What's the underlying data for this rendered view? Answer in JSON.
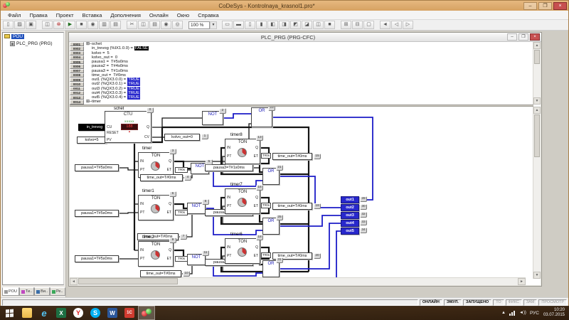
{
  "window": {
    "title": "CoDeSys - Kontrolnaya_krasnol1.pro*",
    "minimize": "–",
    "maximize": "❐",
    "close": "×"
  },
  "menu": {
    "items": [
      "Файл",
      "Правка",
      "Проект",
      "Вставка",
      "Дополнения",
      "Онлайн",
      "Окно",
      "Справка"
    ]
  },
  "toolbar": {
    "zoom_value": "100 %",
    "zoom_drop": "▼",
    "groups": [
      {
        "buttons": [
          {
            "name": "new-file",
            "glyph": "▯"
          },
          {
            "name": "open-file",
            "glyph": "▨"
          },
          {
            "name": "save-file",
            "glyph": "▣"
          }
        ]
      },
      {
        "buttons": [
          {
            "name": "login",
            "glyph": "◫"
          },
          {
            "name": "logout",
            "glyph": "⊗"
          },
          {
            "name": "run",
            "glyph": "▶"
          },
          {
            "name": "stop",
            "glyph": "■"
          },
          {
            "name": "toggle-breakpoint",
            "glyph": "◉"
          },
          {
            "name": "step-over",
            "glyph": "▥"
          },
          {
            "name": "step-in",
            "glyph": "▤"
          }
        ]
      },
      {
        "buttons": [
          {
            "name": "cut",
            "glyph": "✂"
          },
          {
            "name": "copy",
            "glyph": "◫"
          },
          {
            "name": "paste",
            "glyph": "▤"
          },
          {
            "name": "find",
            "glyph": "◉"
          },
          {
            "name": "find-next",
            "glyph": "◎"
          }
        ]
      },
      {
        "buttons": [
          {
            "name": "size-1",
            "glyph": "▭"
          },
          {
            "name": "size-2",
            "glyph": "▬"
          },
          {
            "name": "size-3",
            "glyph": "▯"
          },
          {
            "name": "size-4",
            "glyph": "▮"
          },
          {
            "name": "align-left",
            "glyph": "◧"
          },
          {
            "name": "align-right",
            "glyph": "◨"
          },
          {
            "name": "align-top",
            "glyph": "◩"
          },
          {
            "name": "align-bottom",
            "glyph": "◪"
          },
          {
            "name": "order-front",
            "glyph": "◫"
          },
          {
            "name": "order-back",
            "glyph": "■"
          }
        ]
      },
      {
        "buttons": [
          {
            "name": "zoom-in",
            "glyph": "⊞"
          },
          {
            "name": "zoom-out",
            "glyph": "⊟"
          },
          {
            "name": "zoom-fit",
            "glyph": "▢"
          }
        ]
      },
      {
        "buttons": [
          {
            "name": "go-first",
            "glyph": "◄"
          },
          {
            "name": "go-prev",
            "glyph": "◁"
          },
          {
            "name": "go-next",
            "glyph": "▷"
          }
        ]
      }
    ]
  },
  "sidebar": {
    "root": "POU",
    "child": "PLC_PRG (PRG)",
    "tabs": [
      {
        "label": "POU"
      },
      {
        "label": "Ти.."
      },
      {
        "label": "Ви.."
      },
      {
        "label": "Ре.."
      }
    ]
  },
  "editor": {
    "title": "PLC_PRG (PRG-CFC)",
    "minimize": "–",
    "maximize": "❐",
    "close": "×",
    "declarations": [
      {
        "num": "0001",
        "label": "⊞–schet",
        "value": ""
      },
      {
        "num": "0002",
        "label": "in_trevog (%IX1.0.0) =",
        "value": "FALSE"
      },
      {
        "num": "0003",
        "label": "kolvo =",
        "value": "5"
      },
      {
        "num": "0004",
        "label": "kolvo_out =",
        "value": "0"
      },
      {
        "num": "0005",
        "label": "pausa1 =",
        "value": "T#5s0ms"
      },
      {
        "num": "0006",
        "label": "pausa2 =",
        "value": "T#4s0ms"
      },
      {
        "num": "0007",
        "label": "pausa3 =",
        "value": "T#1s0ms"
      },
      {
        "num": "0008",
        "label": "time_out =",
        "value": "T#0ms"
      },
      {
        "num": "0009",
        "label": "out1 (%QX3.0.0) =",
        "value": "TRUE"
      },
      {
        "num": "0010",
        "label": "out2 (%QX3.0.1) =",
        "value": "TRUE"
      },
      {
        "num": "0011",
        "label": "out3 (%QX3.0.2) =",
        "value": "TRUE"
      },
      {
        "num": "0012",
        "label": "out4 (%QX3.0.3) =",
        "value": "TRUE"
      },
      {
        "num": "0013",
        "label": "out5 (%QX3.0.4) =",
        "value": "TRUE"
      },
      {
        "num": "0014",
        "label": "⊞–timer",
        "value": ""
      }
    ]
  },
  "diagram": {
    "counter": {
      "title": "schet",
      "type": "CTU",
      "cu": "CU",
      "reset": "RESET",
      "pv": "PV",
      "q": "Q",
      "cv": "CV",
      "badge": "0",
      "disp_top": "xxxxx",
      "disp_val": "188",
      "disp_arrow": "▲"
    },
    "not_label": "NOT",
    "or_label": "OR",
    "ton": "TON",
    "pin_in": "IN",
    "pin_pt": "PT",
    "pin_q": "Q",
    "pin_et": "ET",
    "et_val": "T#0s",
    "not_top": {
      "badge": "2"
    },
    "or_top": {
      "badge": "23"
    },
    "in_trevog": {
      "label": "in_trevog"
    },
    "kolvo": {
      "label": "kolvo=5"
    },
    "kolvo_out": {
      "label": "kolvo_out=0",
      "badge": "1"
    },
    "lt": [
      {
        "title": "timer",
        "badge": "3",
        "pausa": "pausa1=T#5s0ms",
        "tout": "time_out=T#0ms",
        "tout_badge": "4",
        "not_badge": "5",
        "pausa3": "pausa3=T#1s0ms"
      },
      {
        "title": "timer1",
        "badge": "6",
        "pausa": "pausa1=T#5s0ms",
        "tout": "time_out=T#0ms",
        "tout_badge": "7",
        "not_badge": "8",
        "pausa3": "pausa3=T#1s0ms"
      },
      {
        "title": "timer2",
        "badge": "9",
        "pausa": "pausa1=T#5s0ms",
        "tout": "time_out=T#0ms",
        "tout_badge": "10",
        "not_badge": "11",
        "pausa3": "pausa3=T#1s0ms"
      }
    ],
    "rt": [
      {
        "title": "timer8",
        "badge": "13",
        "tout": "time_out=T#0ms",
        "tout_badge": "15",
        "or_badge": "21"
      },
      {
        "title": "timer7",
        "badge": "16",
        "tout": "time_out=T#0ms",
        "tout_badge": "19",
        "or_badge": "25"
      },
      {
        "title": "timer6",
        "badge": "18",
        "tout": "time_out=T#0ms",
        "tout_badge": "20",
        "or_badge": "31"
      }
    ],
    "outs": [
      {
        "label": "out1",
        "badge": "28"
      },
      {
        "label": "out2",
        "badge": "30"
      },
      {
        "label": "out3",
        "badge": "32"
      },
      {
        "label": "out4",
        "badge": "33"
      },
      {
        "label": "out5",
        "badge": "34"
      }
    ]
  },
  "statusbar": {
    "items": [
      {
        "label": "ОНЛАЙН"
      },
      {
        "label": "ЭМУЛ."
      },
      {
        "label": "ЗАПУЩЕНО"
      },
      {
        "label": "ТО"
      },
      {
        "label": "ФИКС"
      },
      {
        "label": "ЗАМ"
      },
      {
        "label": "ПРОСМОТР"
      }
    ]
  },
  "taskbar": {
    "icons": {
      "ie": "e",
      "excel": "X",
      "yandex": "Y",
      "skype": "S",
      "word": "W",
      "onec": "1С"
    },
    "tray_chevron": "▲",
    "lang": "РУС",
    "clock_time": "10:20",
    "clock_date": "03.07.2015"
  },
  "colors": {
    "titlebar": "#dcab72",
    "wire_true": "#1c1cc8",
    "wire_false": "#141414",
    "value_true_bg": "#2828cc",
    "value_false_bg": "#000000",
    "close_button": "#c75050",
    "selection_blue": "#1e4fbc"
  }
}
